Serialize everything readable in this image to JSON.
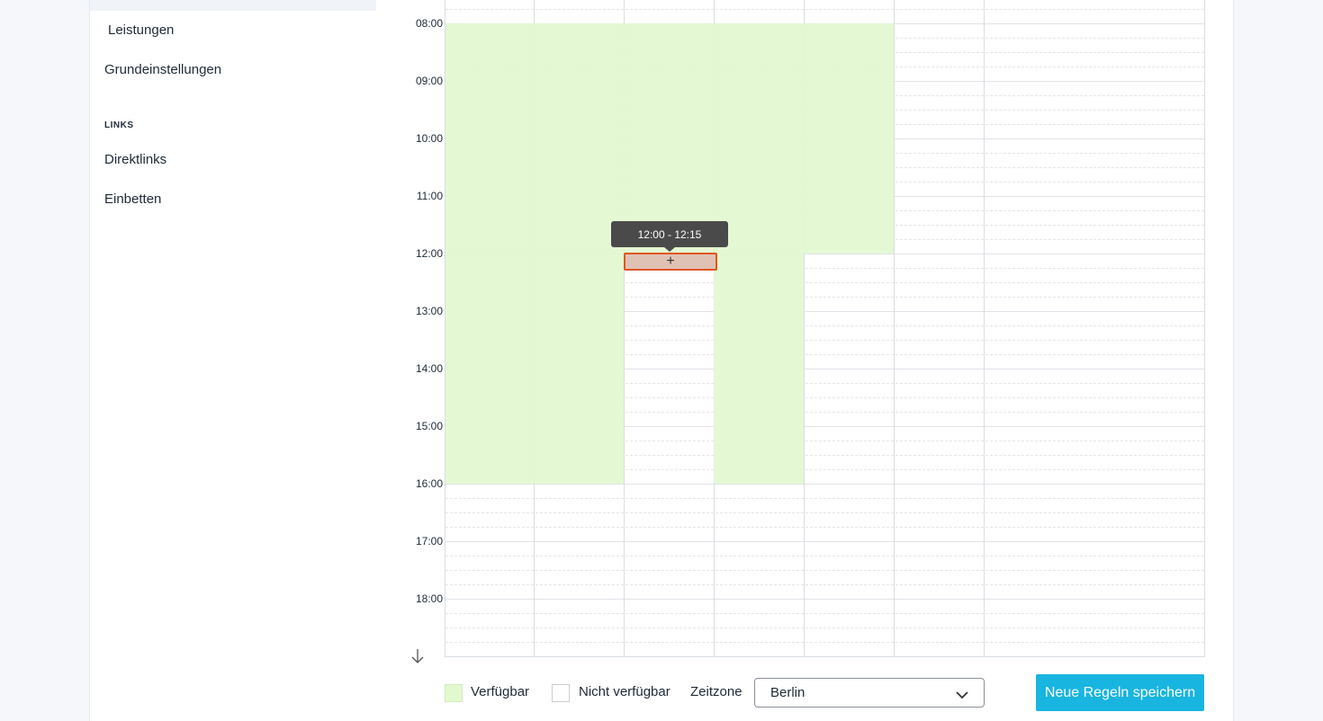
{
  "sidebar": {
    "items_top": [
      {
        "label": "Leistungen"
      },
      {
        "label": "Grundeinstellungen"
      }
    ],
    "links_heading": "LINKS",
    "links": [
      {
        "label": "Direktlinks"
      },
      {
        "label": "Einbetten"
      }
    ]
  },
  "calendar": {
    "hours": [
      "08:00",
      "09:00",
      "10:00",
      "11:00",
      "12:00",
      "13:00",
      "14:00",
      "15:00",
      "16:00",
      "17:00",
      "18:00"
    ],
    "tooltip": "12:00 - 12:15",
    "selection_icon": "plus-icon"
  },
  "footer": {
    "legend_available": "Verfügbar",
    "legend_unavailable": "Nicht verfügbar",
    "timezone_label": "Zeitzone",
    "timezone_value": "Berlin",
    "save_label": "Neue Regeln speichern"
  },
  "colors": {
    "available": "#e2f9cf",
    "selection_border": "#e0561c",
    "accent": "#18b5e0"
  }
}
